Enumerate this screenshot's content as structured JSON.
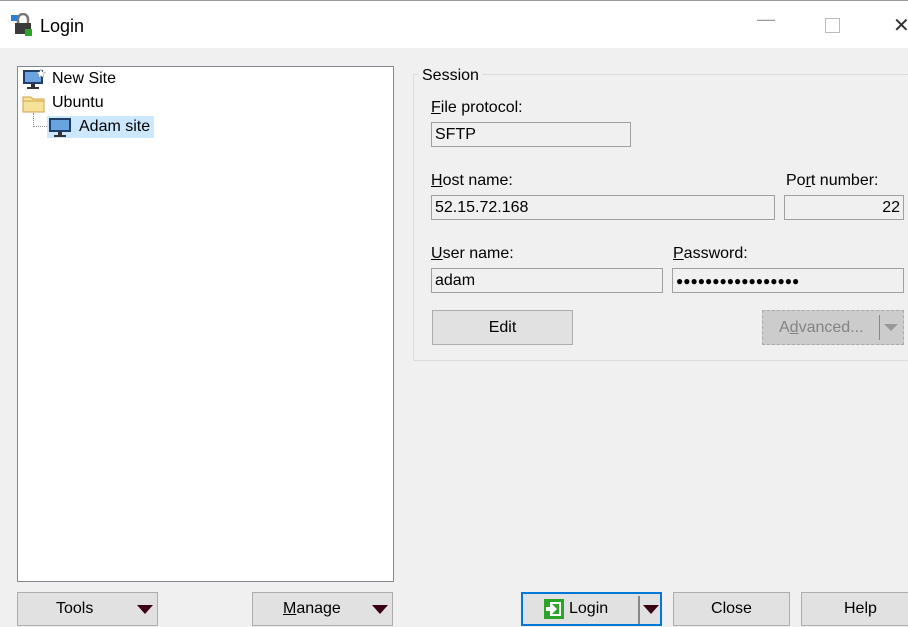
{
  "window": {
    "title": "Login",
    "icon": "padlock-icon",
    "controls": [
      "minimize",
      "maximize",
      "close"
    ]
  },
  "tree": {
    "items": [
      {
        "label": "New Site",
        "icon": "new-site-monitor-icon",
        "level": 0
      },
      {
        "label": "Ubuntu",
        "icon": "folder-icon",
        "level": 0
      },
      {
        "label": "Adam site",
        "icon": "monitor-icon",
        "level": 1,
        "selected": true
      }
    ]
  },
  "session": {
    "group_label": "Session",
    "file_protocol": {
      "label": "File protocol:",
      "accesskey": "F",
      "value": "SFTP"
    },
    "host_name": {
      "label": "Host name:",
      "accesskey": "H",
      "value": "52.15.72.168"
    },
    "port_number": {
      "label": "Port number:",
      "accesskey": "r",
      "value": "22"
    },
    "user_name": {
      "label": "User name:",
      "accesskey": "U",
      "value": "adam"
    },
    "password": {
      "label": "Password:",
      "accesskey": "P",
      "value": "●●●●●●●●●●●●●●●●●"
    },
    "edit_button": {
      "label": "Edit",
      "accesskey": "E"
    },
    "advanced_button": {
      "label": "Advanced...",
      "accesskey": "d",
      "disabled": true
    }
  },
  "buttons": {
    "tools": {
      "label": "Tools",
      "accesskey": "T"
    },
    "manage": {
      "label": "Manage",
      "accesskey": "M"
    },
    "login": {
      "label": "Login"
    },
    "close": {
      "label": "Close"
    },
    "help": {
      "label": "Help"
    }
  },
  "colors": {
    "selection": "#cce8ff",
    "focus_border": "#0078d7",
    "login_icon": "#2aa52a"
  }
}
